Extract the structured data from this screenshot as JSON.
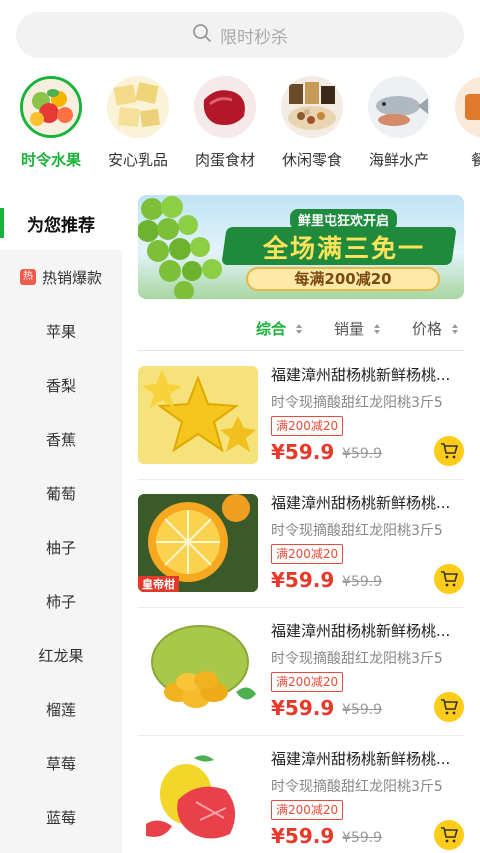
{
  "search": {
    "placeholder": "限时秒杀"
  },
  "categories": [
    {
      "label": "时令水果",
      "icon": "fruit-basket-icon",
      "active": true
    },
    {
      "label": "安心乳品",
      "icon": "dairy-icon",
      "active": false
    },
    {
      "label": "肉蛋食材",
      "icon": "meat-icon",
      "active": false
    },
    {
      "label": "休闲零食",
      "icon": "snacks-icon",
      "active": false
    },
    {
      "label": "海鲜水产",
      "icon": "seafood-icon",
      "active": false
    },
    {
      "label": "餐饮",
      "icon": "dining-icon",
      "active": false
    }
  ],
  "sidebar": {
    "items": [
      {
        "label": "为您推荐",
        "active": true
      },
      {
        "label": "热销爆款",
        "badge": "热"
      },
      {
        "label": "苹果"
      },
      {
        "label": "香梨"
      },
      {
        "label": "香蕉"
      },
      {
        "label": "葡萄"
      },
      {
        "label": "柚子"
      },
      {
        "label": "柿子"
      },
      {
        "label": "红龙果"
      },
      {
        "label": "榴莲"
      },
      {
        "label": "草莓"
      },
      {
        "label": "蓝莓"
      }
    ]
  },
  "banner": {
    "subtitle": "鲜里屯狂欢开启",
    "title": "全场满三免一",
    "promo": "每满200减20"
  },
  "sort": {
    "options": [
      "综合",
      "销量",
      "价格"
    ],
    "active": "综合"
  },
  "products": [
    {
      "name": "福建漳州甜杨桃新鲜杨桃...",
      "desc": "时令现摘酸甜红龙阳桃3斤5",
      "tag": "满200减20",
      "price": "¥59.9",
      "old_price": "¥59.9",
      "image": "starfruit-image"
    },
    {
      "name": "福建漳州甜杨桃新鲜杨桃...",
      "desc": "时令现摘酸甜红龙阳桃3斤5",
      "tag": "满200减20",
      "price": "¥59.9",
      "old_price": "¥59.9",
      "image": "orange-image",
      "image_label": "皇帝柑"
    },
    {
      "name": "福建漳州甜杨桃新鲜杨桃...",
      "desc": "时令现摘酸甜红龙阳桃3斤5",
      "tag": "满200减20",
      "price": "¥59.9",
      "old_price": "¥59.9",
      "image": "jackfruit-image"
    },
    {
      "name": "福建漳州甜杨桃新鲜杨桃...",
      "desc": "时令现摘酸甜红龙阳桃3斤5",
      "tag": "满200减20",
      "price": "¥59.9",
      "old_price": "¥59.9",
      "image": "pomelo-image"
    }
  ],
  "colors": {
    "accent": "#19b33a",
    "price": "#e8382a",
    "cart": "#ffcc1a"
  }
}
